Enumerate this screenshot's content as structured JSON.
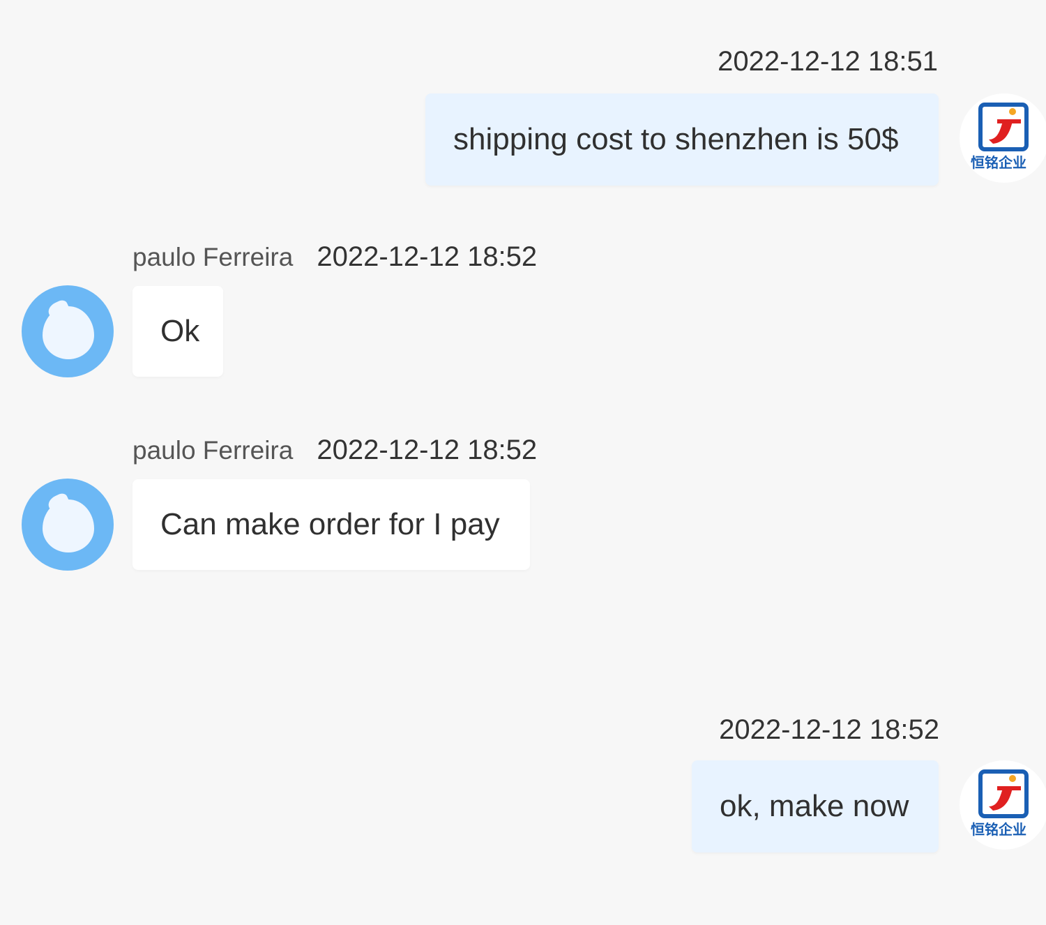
{
  "messages": [
    {
      "direction": "outgoing",
      "timestamp": "2022-12-12 18:51",
      "text": "shipping cost to shenzhen is 50$",
      "avatar": "company-logo-icon"
    },
    {
      "direction": "incoming",
      "sender": "paulo Ferreira",
      "timestamp": "2022-12-12 18:52",
      "text": "Ok",
      "avatar": "user-avatar-icon"
    },
    {
      "direction": "incoming",
      "sender": "paulo Ferreira",
      "timestamp": "2022-12-12 18:52",
      "text": "Can make order for I pay",
      "avatar": "user-avatar-icon"
    },
    {
      "direction": "outgoing",
      "timestamp": "2022-12-12 18:52",
      "text": "ok, make now",
      "avatar": "company-logo-icon"
    }
  ],
  "colors": {
    "background": "#f7f7f7",
    "outgoing_bubble": "#e8f3ff",
    "incoming_bubble": "#ffffff",
    "user_avatar": "#6cb8f5",
    "logo_red": "#e02020",
    "logo_blue": "#1a5fb4"
  }
}
